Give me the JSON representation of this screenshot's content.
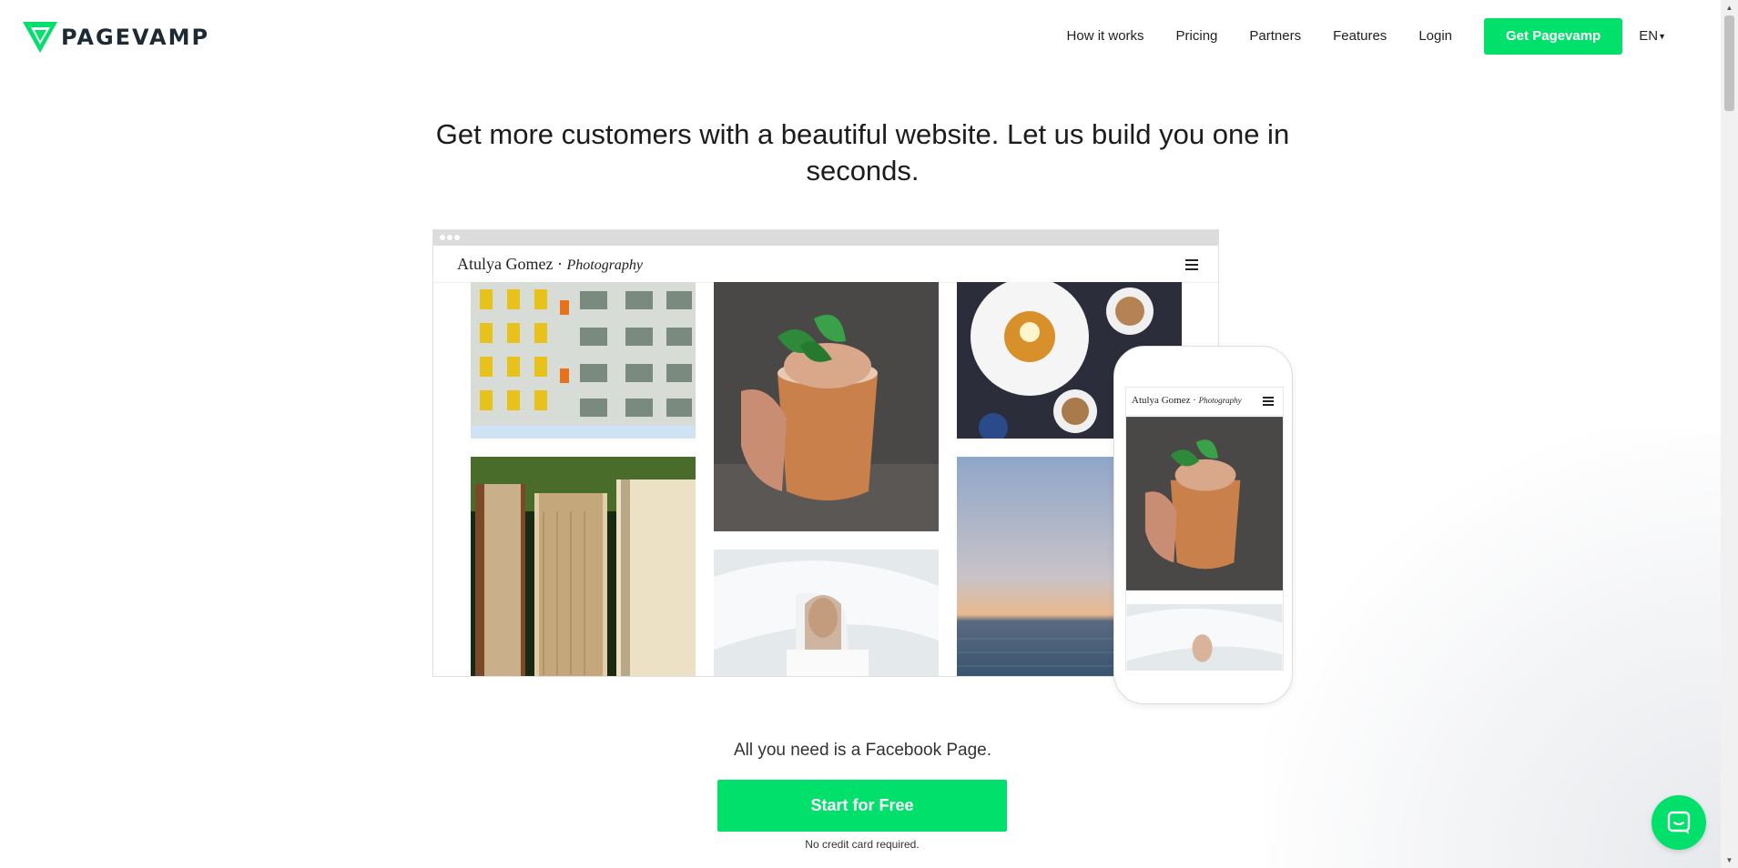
{
  "brand": {
    "name": "PAGEVAMP",
    "accent": "#00e06a",
    "dark": "#1d2a33"
  },
  "nav": {
    "items": [
      "How it works",
      "Pricing",
      "Partners",
      "Features",
      "Login"
    ],
    "cta": "Get Pagevamp",
    "lang": "EN"
  },
  "hero": {
    "headline": "Get more customers with a beautiful website. Let us build you one in seconds."
  },
  "mockup": {
    "site_name": "Atulya Gomez ·",
    "site_sub": "Photography",
    "tiles": [
      "building-photo",
      "cocktail-photo",
      "breakfast-photo",
      "books-photo",
      "veil-girl-photo",
      "sea-sunset-photo"
    ]
  },
  "cta": {
    "tagline": "All you need is a Facebook Page.",
    "button": "Start for Free",
    "note": "No credit card required."
  },
  "icons": {
    "chat": "chat-bubble-icon",
    "menu": "hamburger-icon",
    "caret": "caret-down-icon"
  }
}
